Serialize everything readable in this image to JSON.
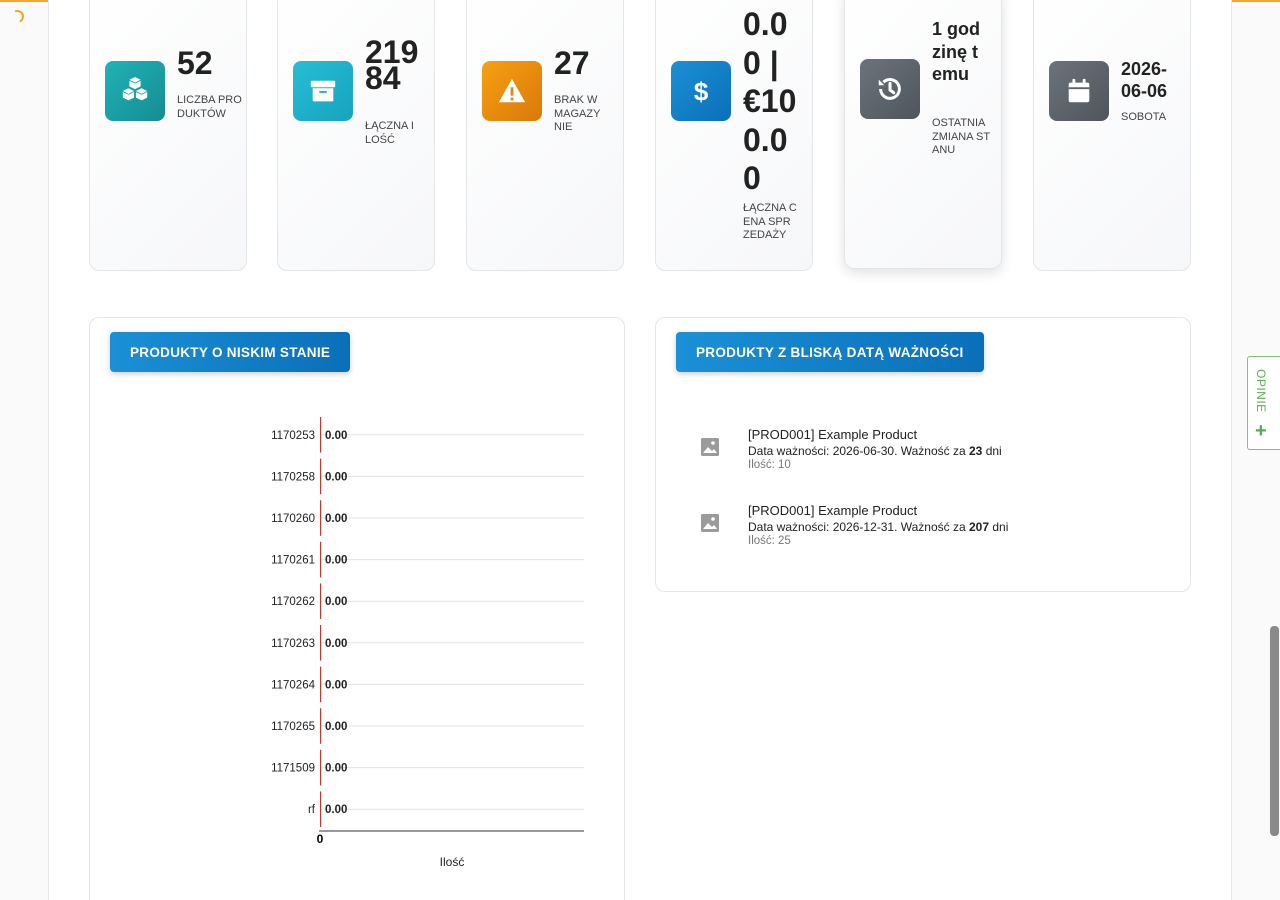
{
  "stats": [
    {
      "value": "52",
      "label": "Liczba produktów",
      "icon": "cubes-icon",
      "color_from": "#1fb3b8",
      "color_to": "#158c91"
    },
    {
      "value": "21984",
      "label": "Łączna ilość",
      "icon": "archive-icon",
      "color_from": "#28bdd6",
      "color_to": "#15a4bd"
    },
    {
      "value": "27",
      "label": "Brak w magazynie",
      "icon": "warning-icon",
      "color_from": "#f7a013",
      "color_to": "#d9790a"
    },
    {
      "value": "0.00 | €100.00",
      "label": "Łączna cena sprzedaży",
      "icon": "dollar-icon",
      "color_from": "#1b90d6",
      "color_to": "#0a6fb8"
    },
    {
      "value": "1 godzinę temu",
      "label": "Ostatnia zmiana stanu",
      "icon": "history-icon",
      "color_from": "#6c737c",
      "color_to": "#4f555c"
    },
    {
      "value": "2026-06-06",
      "label": "Sobota",
      "icon": "calendar-icon",
      "color_from": "#6c737c",
      "color_to": "#4f555c"
    }
  ],
  "low_stock": {
    "title": "Produkty o niskim stanie"
  },
  "expiring": {
    "title": "Produkty z bliską datą ważności",
    "items": [
      {
        "name": "[PROD001] Example Product",
        "date_prefix": "Data ważności: 2026-06-30. Ważność za ",
        "days": "23",
        "days_suffix": " dni",
        "qty": "Ilość: 10"
      },
      {
        "name": "[PROD001] Example Product",
        "date_prefix": "Data ważności: 2026-12-31. Ważność za ",
        "days": "207",
        "days_suffix": " dni",
        "qty": "Ilość: 25"
      }
    ]
  },
  "feedback": {
    "label": "OPINIE"
  },
  "chart_data": {
    "type": "bar",
    "orientation": "horizontal",
    "categories": [
      "1170253",
      "1170258",
      "1170260",
      "1170261",
      "1170262",
      "1170263",
      "1170264",
      "1170265",
      "1171509",
      "rf"
    ],
    "values": [
      0,
      0,
      0,
      0,
      0,
      0,
      0,
      0,
      0,
      0
    ],
    "data_labels": [
      "0.00",
      "0.00",
      "0.00",
      "0.00",
      "0.00",
      "0.00",
      "0.00",
      "0.00",
      "0.00",
      "0.00"
    ],
    "x_ticks": [
      "0"
    ],
    "xlabel": "Ilość",
    "ylabel": "",
    "title": "",
    "grid": true,
    "bar_color": "#c0392b"
  }
}
